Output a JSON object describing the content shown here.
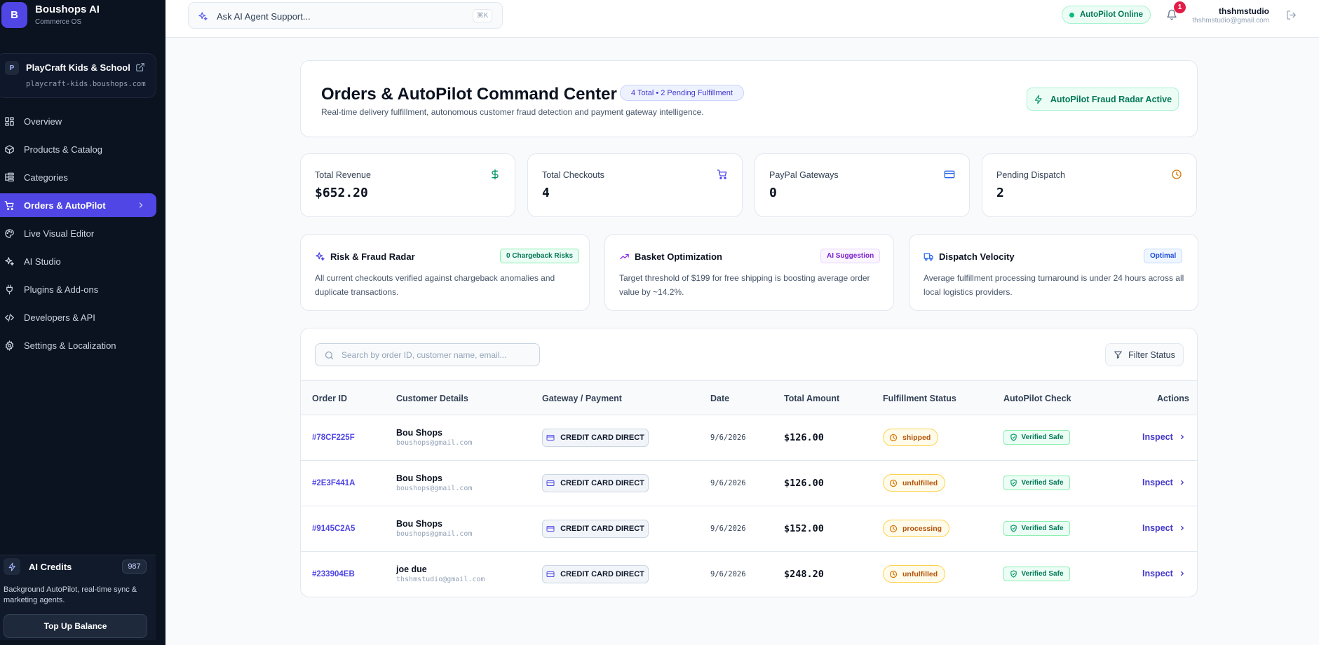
{
  "brand": {
    "logo_letter": "B",
    "title": "Boushops AI",
    "subtitle": "Commerce OS"
  },
  "shop": {
    "badge": "P",
    "name": "PlayCraft Kids & School",
    "domain": "playcraft-kids.boushops.com"
  },
  "sidebar": {
    "items": [
      {
        "label": "Overview",
        "icon": "grid-icon"
      },
      {
        "label": "Products & Catalog",
        "icon": "box-icon"
      },
      {
        "label": "Categories",
        "icon": "list-tree-icon"
      },
      {
        "label": "Orders & AutoPilot",
        "icon": "cart-icon",
        "active": true
      },
      {
        "label": "Live Visual Editor",
        "icon": "palette-icon"
      },
      {
        "label": "AI Studio",
        "icon": "sparkles-icon"
      },
      {
        "label": "Plugins & Add-ons",
        "icon": "plug-icon"
      },
      {
        "label": "Developers & API",
        "icon": "code-icon"
      },
      {
        "label": "Settings & Localization",
        "icon": "gear-icon"
      }
    ]
  },
  "credits": {
    "title": "AI Credits",
    "count": "987",
    "description": "Background AutoPilot, real-time sync & marketing agents.",
    "topup_label": "Top Up Balance"
  },
  "topbar": {
    "ask_placeholder": "Ask AI Agent Support...",
    "shortcut": "⌘K",
    "status": "AutoPilot Online",
    "notifications": "1",
    "user_name": "thshmstudio",
    "user_email": "thshmstudio@gmail.com"
  },
  "header": {
    "title": "Orders & AutoPilot Command Center",
    "pill": "4 Total • 2 Pending Fulfillment",
    "subtitle": "Real-time delivery fulfillment, autonomous customer fraud detection and payment gateway intelligence.",
    "fraud_button": "AutoPilot Fraud Radar Active"
  },
  "stats": [
    {
      "label": "Total Revenue",
      "value": "$652.20",
      "icon": "dollar-icon",
      "color": "#059669"
    },
    {
      "label": "Total Checkouts",
      "value": "4",
      "icon": "cart-icon",
      "color": "#4f46e5"
    },
    {
      "label": "PayPal Gateways",
      "value": "0",
      "icon": "credit-card-icon",
      "color": "#2563eb"
    },
    {
      "label": "Pending Dispatch",
      "value": "2",
      "icon": "clock-icon",
      "color": "#d97706"
    }
  ],
  "insights": [
    {
      "title": "Risk & Fraud Radar",
      "tag": "0 Chargeback Risks",
      "description": "All current checkouts verified against chargeback anomalies and duplicate transactions.",
      "icon": "sparkles-icon"
    },
    {
      "title": "Basket Optimization",
      "tag": "AI Suggestion",
      "description": "Target threshold of $199 for free shipping is boosting average order value by ~14.2%.",
      "icon": "trending-up-icon"
    },
    {
      "title": "Dispatch Velocity",
      "tag": "Optimal",
      "description": "Average fulfillment processing turnaround is under 24 hours across all local logistics providers.",
      "icon": "truck-icon"
    }
  ],
  "orders": {
    "search_placeholder": "Search by order ID, customer name, email...",
    "filter_label": "Filter Status",
    "columns": [
      "Order ID",
      "Customer Details",
      "Gateway / Payment",
      "Date",
      "Total Amount",
      "Fulfillment Status",
      "AutoPilot Check",
      "Actions"
    ],
    "rows": [
      {
        "id": "#78CF225F",
        "name": "Bou Shops",
        "email": "boushops@gmail.com",
        "gateway": "CREDIT CARD DIRECT",
        "date": "9/6/2026",
        "amount": "$126.00",
        "status": "shipped",
        "check": "Verified Safe",
        "action": "Inspect"
      },
      {
        "id": "#2E3F441A",
        "name": "Bou Shops",
        "email": "boushops@gmail.com",
        "gateway": "CREDIT CARD DIRECT",
        "date": "9/6/2026",
        "amount": "$126.00",
        "status": "unfulfilled",
        "check": "Verified Safe",
        "action": "Inspect"
      },
      {
        "id": "#9145C2A5",
        "name": "Bou Shops",
        "email": "boushops@gmail.com",
        "gateway": "CREDIT CARD DIRECT",
        "date": "9/6/2026",
        "amount": "$152.00",
        "status": "processing",
        "check": "Verified Safe",
        "action": "Inspect"
      },
      {
        "id": "#233904EB",
        "name": "joe due",
        "email": "thshmstudio@gmail.com",
        "gateway": "CREDIT CARD DIRECT",
        "date": "9/6/2026",
        "amount": "$248.20",
        "status": "unfulfilled",
        "check": "Verified Safe",
        "action": "Inspect"
      }
    ]
  },
  "colors": {
    "accent": "#4f46e5",
    "sidebar_bg": "#0b1220",
    "success": "#047857",
    "warning": "#b45309"
  }
}
